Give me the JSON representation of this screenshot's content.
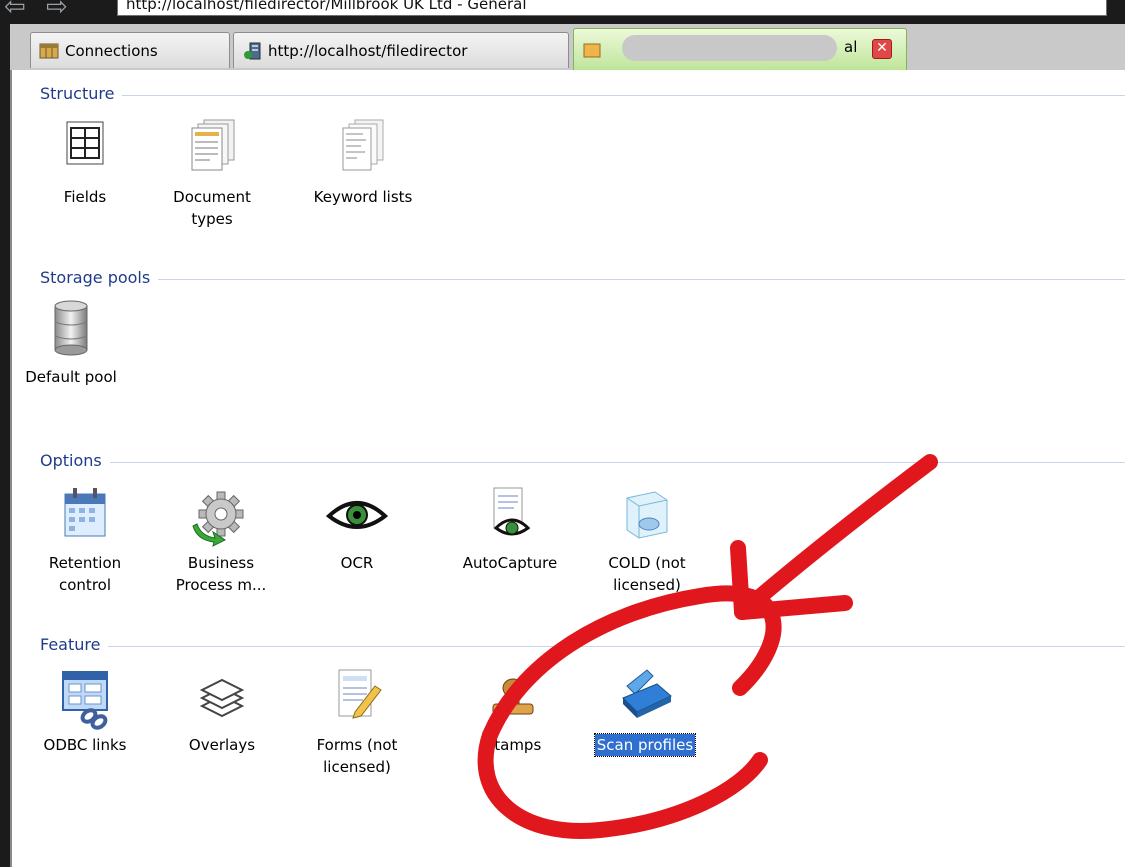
{
  "address_bar": {
    "url": "http://localhost/filedirector/Millbrook UK Ltd - General"
  },
  "tabs": [
    {
      "label": "Connections",
      "icon": "connections-icon"
    },
    {
      "label": "http://localhost/filedirector",
      "icon": "server-icon"
    },
    {
      "label": "al",
      "icon": "folder-icon",
      "active": true,
      "close_icon": "✕"
    }
  ],
  "sections": {
    "structure": {
      "title": "Structure",
      "items": [
        {
          "label": "Fields",
          "icon": "fields-table-icon"
        },
        {
          "label": "Document types",
          "icon": "document-types-icon"
        },
        {
          "label": "Keyword lists",
          "icon": "keyword-lists-icon"
        }
      ]
    },
    "storage": {
      "title": "Storage pools",
      "items": [
        {
          "label": "Default pool",
          "icon": "database-icon"
        }
      ]
    },
    "options": {
      "title": "Options",
      "items": [
        {
          "label": "Retention control",
          "icon": "calendar-icon"
        },
        {
          "label": "Business Process m...",
          "icon": "gear-icon"
        },
        {
          "label": "OCR",
          "icon": "eye-icon"
        },
        {
          "label": "AutoCapture",
          "icon": "autocapture-eye-icon"
        },
        {
          "label": "COLD (not licensed)",
          "icon": "cold-cube-icon"
        }
      ]
    },
    "feature": {
      "title": "Feature",
      "items": [
        {
          "label": "ODBC links",
          "icon": "odbc-link-icon"
        },
        {
          "label": "Overlays",
          "icon": "layers-icon"
        },
        {
          "label": "Forms (not licensed)",
          "icon": "form-pencil-icon"
        },
        {
          "label": "Stamps",
          "icon": "stamp-icon"
        },
        {
          "label": "Scan profiles",
          "icon": "scanner-icon",
          "selected": true
        }
      ]
    }
  },
  "colors": {
    "section_title": "#1f3c8a",
    "selection": "#2f6fd0",
    "annotation": "#e0181d"
  }
}
